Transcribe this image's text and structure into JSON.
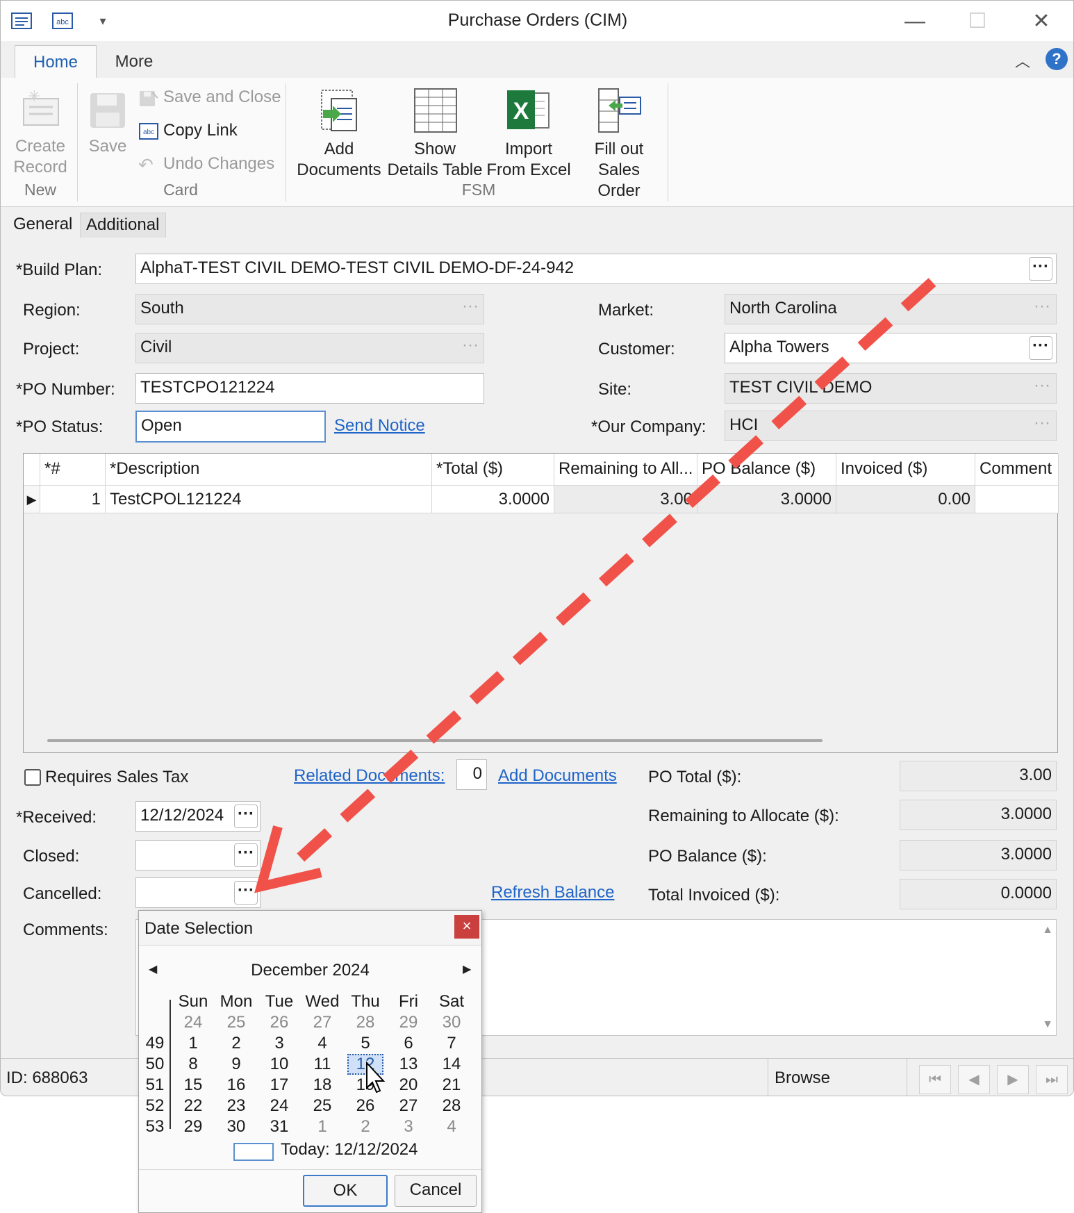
{
  "window": {
    "title": "Purchase Orders (CIM)"
  },
  "ribbon": {
    "tabs": [
      "Home",
      "More"
    ],
    "new_group": {
      "label": "New",
      "create_record_line1": "Create",
      "create_record_line2": "Record"
    },
    "card_group": {
      "label": "Card",
      "save": "Save",
      "save_and_close": "Save and Close",
      "copy_link": "Copy Link",
      "undo_changes": "Undo Changes"
    },
    "fsm_group": {
      "label": "FSM",
      "add_documents": [
        "Add",
        "Documents"
      ],
      "show_details_table": [
        "Show",
        "Details Table"
      ],
      "import_from_excel": [
        "Import",
        "From Excel"
      ],
      "fill_out_sales_order": [
        "Fill out",
        "Sales Order"
      ]
    }
  },
  "form_tabs": [
    "General",
    "Additional"
  ],
  "form": {
    "build_plan": {
      "label": "*Build Plan:",
      "value": "AlphaT-TEST CIVIL DEMO-TEST CIVIL DEMO-DF-24-942"
    },
    "region": {
      "label": "Region:",
      "value": "South"
    },
    "project": {
      "label": "Project:",
      "value": "Civil"
    },
    "po_number": {
      "label": "*PO Number:",
      "value": "TESTCPO121224"
    },
    "po_status": {
      "label": "*PO Status:",
      "value": "Open"
    },
    "send_notice": "Send Notice",
    "market": {
      "label": "Market:",
      "value": "North Carolina"
    },
    "customer": {
      "label": "Customer:",
      "value": "Alpha Towers"
    },
    "site": {
      "label": "Site:",
      "value": "TEST CIVIL DEMO"
    },
    "our_company": {
      "label": "*Our Company:",
      "value": "HCI"
    },
    "dots": "···"
  },
  "grid": {
    "columns": [
      "*#",
      "*Description",
      "*Total ($)",
      "Remaining to All...",
      "PO Balance ($)",
      "Invoiced ($)",
      "Comment"
    ],
    "rows": [
      {
        "num": "1",
        "description": "TestCPOL121224",
        "total": "3.0000",
        "remaining": "3.00",
        "balance": "3.0000",
        "invoiced": "0.00",
        "comment": ""
      }
    ]
  },
  "lower": {
    "requires_sales_tax": "Requires Sales Tax",
    "related_documents": "Related Documents:",
    "related_count": "0",
    "add_documents": "Add Documents",
    "received": {
      "label": "*Received:",
      "value": "12/12/2024"
    },
    "closed": {
      "label": "Closed:",
      "value": ""
    },
    "cancelled": {
      "label": "Cancelled:",
      "value": ""
    },
    "comments": {
      "label": "Comments:"
    },
    "refresh_balance": "Refresh Balance",
    "po_total": {
      "label": "PO Total ($):",
      "value": "3.00"
    },
    "remaining_to_allocate": {
      "label": "Remaining to Allocate ($):",
      "value": "3.0000"
    },
    "po_balance": {
      "label": "PO Balance ($):",
      "value": "3.0000"
    },
    "total_invoiced": {
      "label": "Total Invoiced ($):",
      "value": "0.0000"
    }
  },
  "status_bar": {
    "id": "ID: 688063",
    "mode": "Browse"
  },
  "date_dialog": {
    "title": "Date Selection",
    "close": "×",
    "month": "December 2024",
    "weekdays": [
      "Sun",
      "Mon",
      "Tue",
      "Wed",
      "Thu",
      "Fri",
      "Sat"
    ],
    "weeks": [
      {
        "num": "",
        "days": [
          "24",
          "25",
          "26",
          "27",
          "28",
          "29",
          "30"
        ],
        "gray": [
          true,
          true,
          true,
          true,
          true,
          true,
          true
        ]
      },
      {
        "num": "49",
        "days": [
          "1",
          "2",
          "3",
          "4",
          "5",
          "6",
          "7"
        ],
        "gray": [
          false,
          false,
          false,
          false,
          false,
          false,
          false
        ]
      },
      {
        "num": "50",
        "days": [
          "8",
          "9",
          "10",
          "11",
          "12",
          "13",
          "14"
        ],
        "gray": [
          false,
          false,
          false,
          false,
          false,
          false,
          false
        ]
      },
      {
        "num": "51",
        "days": [
          "15",
          "16",
          "17",
          "18",
          "19",
          "20",
          "21"
        ],
        "gray": [
          false,
          false,
          false,
          false,
          false,
          false,
          false
        ]
      },
      {
        "num": "52",
        "days": [
          "22",
          "23",
          "24",
          "25",
          "26",
          "27",
          "28"
        ],
        "gray": [
          false,
          false,
          false,
          false,
          false,
          false,
          false
        ]
      },
      {
        "num": "53",
        "days": [
          "29",
          "30",
          "31",
          "1",
          "2",
          "3",
          "4"
        ],
        "gray": [
          false,
          false,
          false,
          true,
          true,
          true,
          true
        ]
      }
    ],
    "selected_day": "12",
    "today": "Today: 12/12/2024",
    "ok": "OK",
    "cancel": "Cancel"
  },
  "colors": {
    "link": "#1f64c8",
    "annotation_arrow": "#f0524a",
    "accent": "#1e5fb0"
  }
}
